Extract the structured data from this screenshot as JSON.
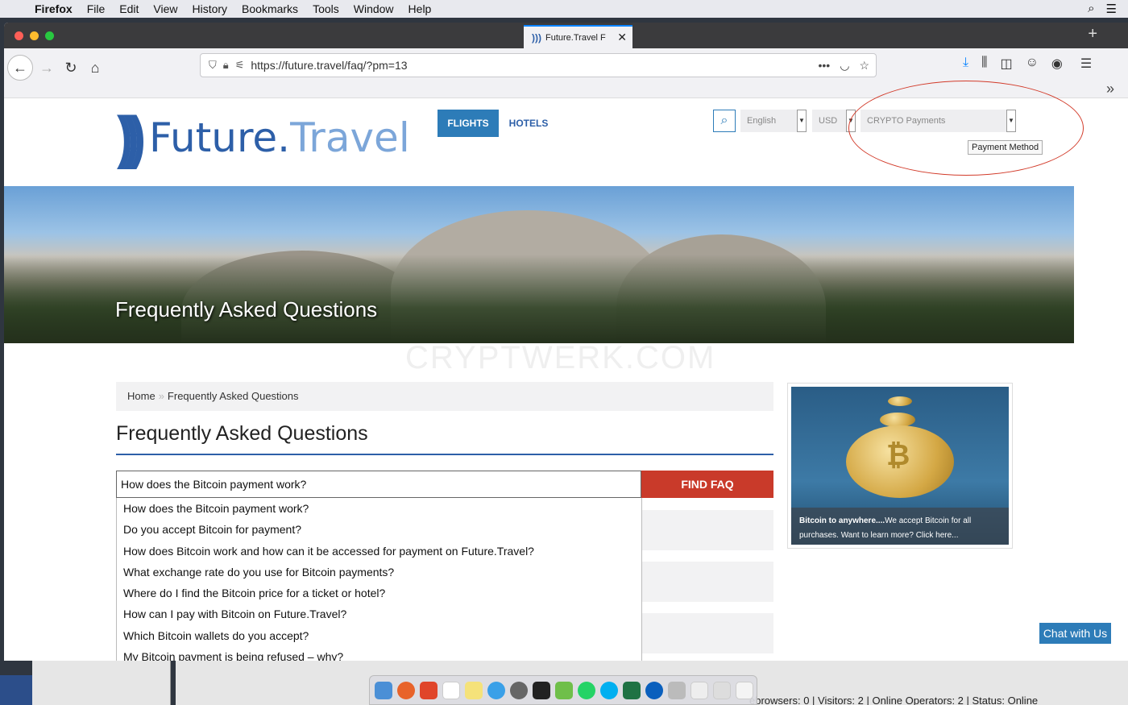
{
  "menubar": {
    "app": "Firefox",
    "items": [
      "File",
      "Edit",
      "View",
      "History",
      "Bookmarks",
      "Tools",
      "Window",
      "Help"
    ]
  },
  "tab": {
    "title": "Future.Travel F"
  },
  "url": "https://future.travel/faq/?pm=13",
  "site": {
    "logo_part1": "Future.",
    "logo_part2": "Travel",
    "nav": {
      "flights": "FLIGHTS",
      "hotels": "HOTELS"
    },
    "language": "English",
    "currency": "USD",
    "payment": "CRYPTO Payments",
    "tooltip": "Payment Method",
    "banner_title": "Frequently Asked Questions",
    "watermark": "CRYPTWERK.COM",
    "breadcrumb": {
      "home": "Home",
      "sep": "»",
      "current": "Frequently Asked Questions"
    },
    "heading": "Frequently Asked Questions",
    "search_value": "How does the Bitcoin payment work?",
    "find_button": "FIND FAQ",
    "suggestions": [
      "How does the Bitcoin payment work?",
      "Do you accept Bitcoin for payment?",
      "How does Bitcoin work and how can it be accessed for payment on Future.Travel?",
      "What exchange rate do you use for Bitcoin payments?",
      "Where do I find the Bitcoin price for a ticket or hotel?",
      "How can I pay with Bitcoin on Future.Travel?",
      "Which Bitcoin wallets do you accept?",
      "My Bitcoin payment is being refused – why?"
    ],
    "promo": {
      "bold": "Bitcoin to anywhere....",
      "text": "We accept Bitcoin for all purchases. Want to learn more? Click here..."
    },
    "chat": "Chat with Us"
  },
  "statusbar": "ebrowsers: 0 | Visitors: 2 | Online Operators: 2 | Status: Online",
  "colors": {
    "brand": "#2d5fa8",
    "accent_red": "#c93a2a",
    "button_blue": "#2d7cb8"
  }
}
